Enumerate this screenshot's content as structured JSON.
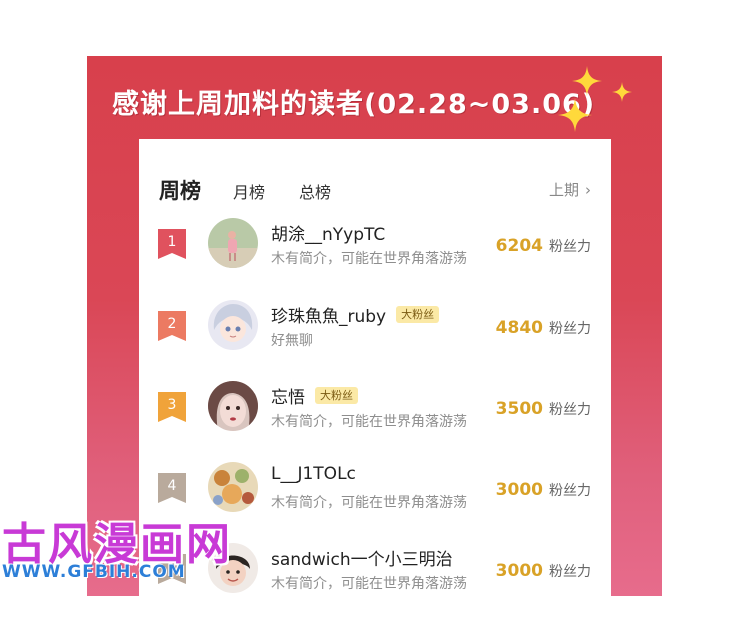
{
  "header": {
    "title": "感谢上周加料的读者(02.28~03.06)"
  },
  "tabs": [
    {
      "label": "周榜",
      "active": true
    },
    {
      "label": "月榜",
      "active": false
    },
    {
      "label": "总榜",
      "active": false
    }
  ],
  "prev_link": {
    "label": "上期",
    "icon": "chevron-right-icon"
  },
  "score_unit": "粉丝力",
  "rows": [
    {
      "rank": "1",
      "name": "胡涂__nYypTC",
      "badge": "",
      "bio": "木有简介，可能在世界角落游荡",
      "score": "6204",
      "rank_color": "#e0525e"
    },
    {
      "rank": "2",
      "name": "珍珠魚魚_ruby",
      "badge": "大粉丝",
      "bio": "好無聊",
      "score": "4840",
      "rank_color": "#ec7a62"
    },
    {
      "rank": "3",
      "name": "忘悟",
      "badge": "大粉丝",
      "bio": "木有简介，可能在世界角落游荡",
      "score": "3500",
      "rank_color": "#f0a33a"
    },
    {
      "rank": "4",
      "name": "L__J1TOLc",
      "badge": "",
      "bio": "木有简介，可能在世界角落游荡",
      "score": "3000",
      "rank_color": "#b9aa9c"
    },
    {
      "rank": "5",
      "name": "sandwich一个小三明治",
      "badge": "",
      "bio": "木有简介，可能在世界角落游荡",
      "score": "3000",
      "rank_color": "#b9aa9c"
    }
  ],
  "watermark": {
    "text": "古风漫画网",
    "url": "WWW.GFBIH.COM"
  },
  "colors": {
    "poster_red": "#d8404c",
    "score_gold": "#d9a227",
    "badge_bg": "#fbe9a6"
  }
}
